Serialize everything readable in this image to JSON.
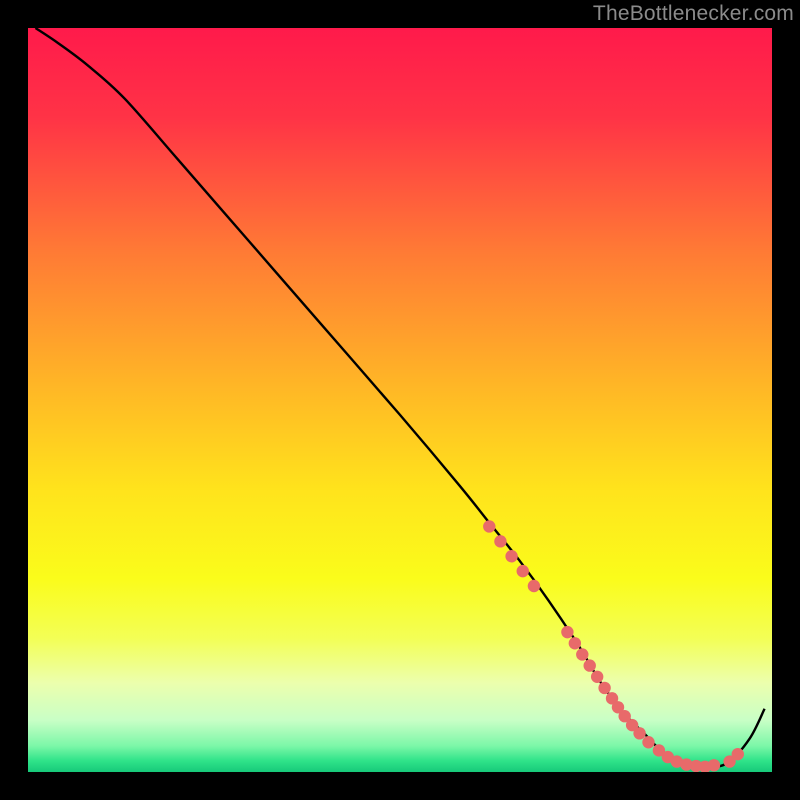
{
  "attribution": "TheBottlenecker.com",
  "chart_data": {
    "type": "line",
    "title": "",
    "xlabel": "",
    "ylabel": "",
    "xlim": [
      0,
      100
    ],
    "ylim": [
      0,
      100
    ],
    "background_gradient": {
      "stops": [
        {
          "offset": 0.0,
          "color": "#ff1a4b"
        },
        {
          "offset": 0.12,
          "color": "#ff3346"
        },
        {
          "offset": 0.3,
          "color": "#ff7a35"
        },
        {
          "offset": 0.48,
          "color": "#ffb626"
        },
        {
          "offset": 0.62,
          "color": "#ffe31c"
        },
        {
          "offset": 0.74,
          "color": "#fafc1b"
        },
        {
          "offset": 0.82,
          "color": "#f3ff55"
        },
        {
          "offset": 0.88,
          "color": "#ecffad"
        },
        {
          "offset": 0.93,
          "color": "#c9ffc6"
        },
        {
          "offset": 0.965,
          "color": "#7cf7a8"
        },
        {
          "offset": 0.985,
          "color": "#2fe389"
        },
        {
          "offset": 1.0,
          "color": "#17c97a"
        }
      ]
    },
    "series": [
      {
        "name": "bottleneck-curve",
        "color": "#000000",
        "x": [
          1,
          4,
          8,
          13,
          20,
          30,
          40,
          50,
          58,
          62,
          66,
          70,
          74,
          77,
          80,
          83,
          85,
          88,
          91,
          94,
          97,
          99
        ],
        "y": [
          100,
          98,
          95,
          90.5,
          82.5,
          71,
          59.5,
          48,
          38.5,
          33.5,
          28.5,
          23,
          17,
          12,
          8,
          5,
          3,
          1.3,
          0.7,
          1.2,
          4.5,
          8.5
        ]
      }
    ],
    "markers": {
      "name": "highlight-dots",
      "color": "#e86a6a",
      "radius_px": 6.2,
      "points": [
        {
          "x": 62.0,
          "y": 33.0
        },
        {
          "x": 63.5,
          "y": 31.0
        },
        {
          "x": 65.0,
          "y": 29.0
        },
        {
          "x": 66.5,
          "y": 27.0
        },
        {
          "x": 68.0,
          "y": 25.0
        },
        {
          "x": 72.5,
          "y": 18.8
        },
        {
          "x": 73.5,
          "y": 17.3
        },
        {
          "x": 74.5,
          "y": 15.8
        },
        {
          "x": 75.5,
          "y": 14.3
        },
        {
          "x": 76.5,
          "y": 12.8
        },
        {
          "x": 77.5,
          "y": 11.3
        },
        {
          "x": 78.5,
          "y": 9.9
        },
        {
          "x": 79.3,
          "y": 8.7
        },
        {
          "x": 80.2,
          "y": 7.5
        },
        {
          "x": 81.2,
          "y": 6.3
        },
        {
          "x": 82.2,
          "y": 5.2
        },
        {
          "x": 83.4,
          "y": 4.0
        },
        {
          "x": 84.8,
          "y": 2.9
        },
        {
          "x": 86.0,
          "y": 2.0
        },
        {
          "x": 87.2,
          "y": 1.4
        },
        {
          "x": 88.5,
          "y": 1.0
        },
        {
          "x": 89.8,
          "y": 0.8
        },
        {
          "x": 91.0,
          "y": 0.7
        },
        {
          "x": 92.2,
          "y": 0.9
        },
        {
          "x": 94.3,
          "y": 1.4
        },
        {
          "x": 95.4,
          "y": 2.4
        }
      ]
    }
  }
}
